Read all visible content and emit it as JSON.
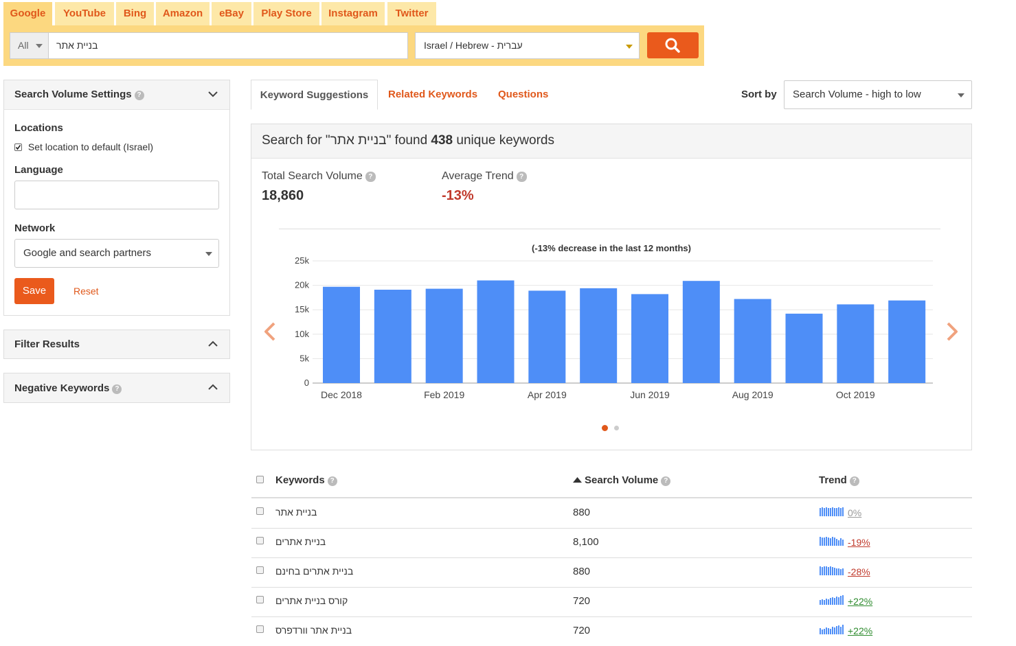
{
  "engines": [
    "Google",
    "YouTube",
    "Bing",
    "Amazon",
    "eBay",
    "Play Store",
    "Instagram",
    "Twitter"
  ],
  "search": {
    "scope": "All",
    "query": "בניית אתר",
    "location": "Israel / Hebrew - עברית"
  },
  "sidebar": {
    "volume_settings": {
      "title": "Search Volume Settings",
      "locations_label": "Locations",
      "default_location_label": "Set location to default (Israel)",
      "default_location_checked": true,
      "language_label": "Language",
      "language_value": "",
      "network_label": "Network",
      "network_value": "Google and search partners",
      "save_label": "Save",
      "reset_label": "Reset"
    },
    "filter_title": "Filter Results",
    "negative_title": "Negative Keywords"
  },
  "main_tabs": [
    "Keyword Suggestions",
    "Related Keywords",
    "Questions"
  ],
  "sort": {
    "label": "Sort by",
    "value": "Search Volume - high to low"
  },
  "summary": {
    "prefix": "Search for \"",
    "query": "בניית אתר",
    "middle": "\" found ",
    "count": "438",
    "suffix": " unique keywords",
    "total_label": "Total Search Volume",
    "total_value": "18,860",
    "trend_label": "Average Trend",
    "trend_value": "-13%"
  },
  "colors": {
    "accent": "#ea5a1c",
    "bar": "#4e8ef7",
    "negative": "#c0392b",
    "positive": "#2e8b2e"
  },
  "chart_data": {
    "type": "bar",
    "title": "(-13% decrease in the last 12 months)",
    "categories": [
      "Dec 2018",
      "Jan 2019",
      "Feb 2019",
      "Mar 2019",
      "Apr 2019",
      "May 2019",
      "Jun 2019",
      "Jul 2019",
      "Aug 2019",
      "Sep 2019",
      "Oct 2019",
      "Nov 2019"
    ],
    "x_tick_labels": [
      "Dec 2018",
      "Feb 2019",
      "Apr 2019",
      "Jun 2019",
      "Aug 2019",
      "Oct 2019"
    ],
    "values": [
      19700,
      19100,
      19300,
      21000,
      18900,
      19400,
      18200,
      20900,
      17200,
      14200,
      16100,
      16900
    ],
    "y_ticks": [
      "0",
      "5k",
      "10k",
      "15k",
      "20k",
      "25k"
    ],
    "ylim": [
      0,
      25000
    ],
    "grid": true,
    "legend": "none"
  },
  "table": {
    "headers": {
      "keywords": "Keywords",
      "volume": "Search Volume",
      "trend": "Trend"
    },
    "rows": [
      {
        "keyword": "בניית אתר",
        "volume": "880",
        "trend": "0%",
        "dir": "neutral"
      },
      {
        "keyword": "בניית אתרים",
        "volume": "8,100",
        "trend": "-19%",
        "dir": "negative"
      },
      {
        "keyword": "בניית אתרים בחינם",
        "volume": "880",
        "trend": "-28%",
        "dir": "negative"
      },
      {
        "keyword": "קורס בניית אתרים",
        "volume": "720",
        "trend": "+22%",
        "dir": "positive"
      },
      {
        "keyword": "בניית אתר וורדפרס",
        "volume": "720",
        "trend": "+22%",
        "dir": "positive"
      }
    ]
  }
}
